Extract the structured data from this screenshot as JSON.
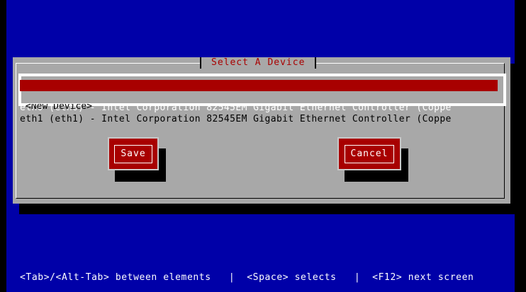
{
  "dialog": {
    "title": "Select A Device",
    "devices": [
      "eth0 (eth0) - Intel Corporation 82545EM Gigabit Ethernet Controller (Coppe",
      "eth1 (eth1) - Intel Corporation 82545EM Gigabit Ethernet Controller (Coppe",
      "<New Device>"
    ],
    "selected_index": 0,
    "buttons": {
      "save": "Save",
      "cancel": "Cancel"
    }
  },
  "status_bar": {
    "text": "<Tab>/<Alt-Tab> between elements   |  <Space> selects   |  <F12> next screen"
  },
  "colors": {
    "screen_bg": "#0000a8",
    "dialog_bg": "#a8a8a8",
    "accent_red": "#a80000",
    "text_white": "#ffffff",
    "text_black": "#000000"
  }
}
